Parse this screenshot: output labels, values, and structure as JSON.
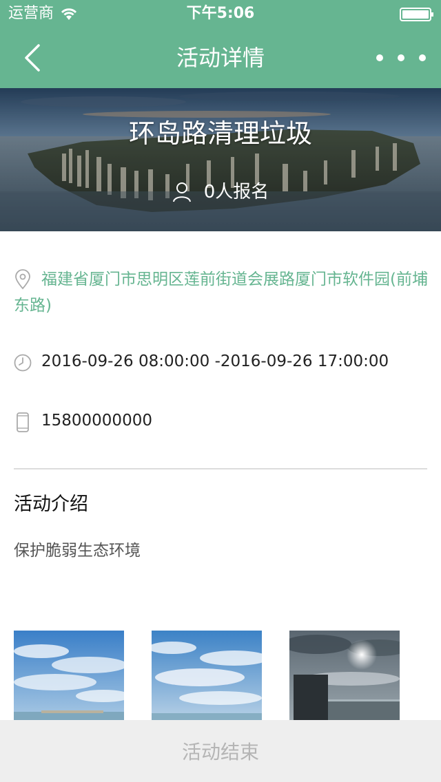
{
  "status_bar": {
    "carrier": "运营商",
    "time": "下午5:06"
  },
  "nav": {
    "title": "活动详情",
    "back_icon": "chevron-left-icon",
    "more_icon": "more-dots-icon"
  },
  "hero": {
    "title": "环岛路清理垃圾",
    "signup_text": "0人报名"
  },
  "info": {
    "address": "福建省厦门市思明区莲前街道会展路厦门市软件园(前埔东路)",
    "time": "2016-09-26 08:00:00 -2016-09-26 17:00:00",
    "phone": "15800000000"
  },
  "intro": {
    "heading": "活动介绍",
    "text": "保护脆弱生态环境"
  },
  "footer": {
    "button_label": "活动结束"
  },
  "colors": {
    "accent": "#66b591",
    "footer_bg": "#eeeeee",
    "footer_text": "#b5b5b5"
  }
}
